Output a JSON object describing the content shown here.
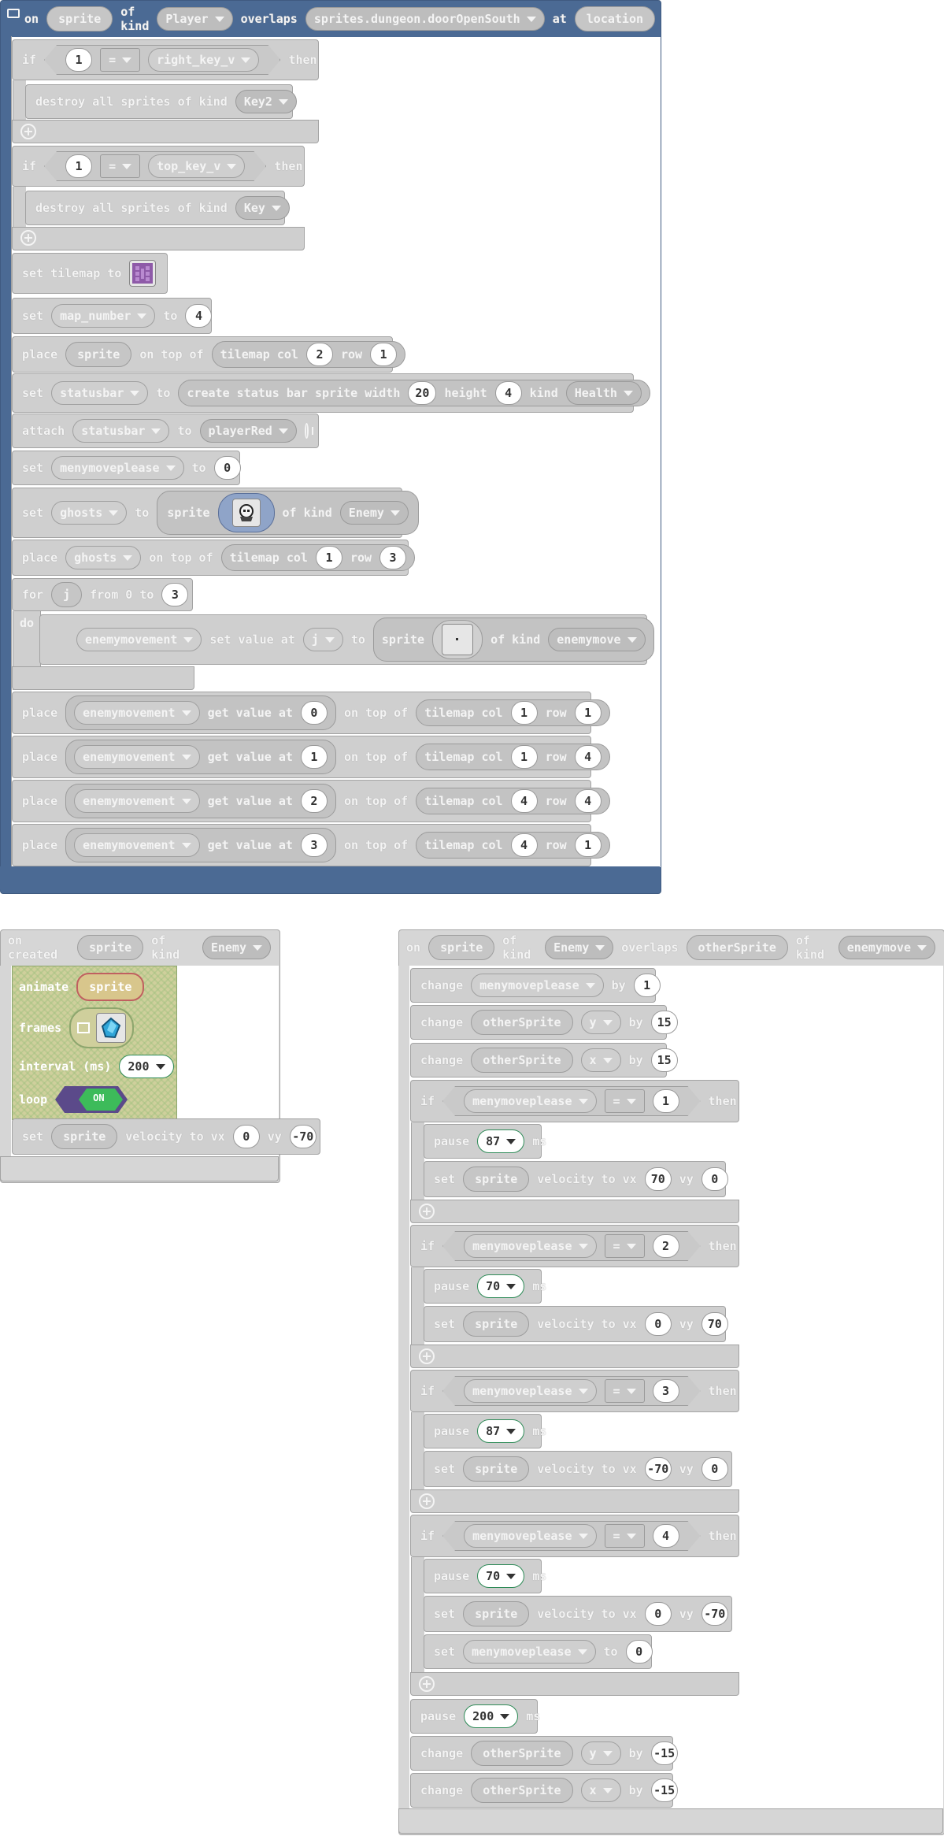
{
  "overlap_event": {
    "on": "on",
    "sprite": "sprite",
    "of_kind": "of kind",
    "player_kind": "Player",
    "overlaps": "overlaps",
    "door": "sprites.dungeon.doorOpenSouth",
    "at": "at",
    "location": "location",
    "if1": {
      "if": "if",
      "num": "1",
      "op": "=",
      "var": "right_key_v",
      "then": "then"
    },
    "destroy1": {
      "text": "destroy all sprites of kind",
      "kind": "Key2"
    },
    "if2": {
      "if": "if",
      "num": "1",
      "op": "=",
      "var": "top_key_v",
      "then": "then"
    },
    "destroy2": {
      "text": "destroy all sprites of kind",
      "kind": "Key"
    },
    "set_tilemap": "set tilemap to",
    "set_map": {
      "set": "set",
      "var": "map_number",
      "to": "to",
      "value": "4"
    },
    "place1": {
      "place": "place",
      "sprite": "sprite",
      "ontop": "on top of",
      "tilemap_col": "tilemap col",
      "col": "2",
      "row_label": "row",
      "row": "1"
    },
    "set_status": {
      "set": "set",
      "var": "statusbar",
      "to": "to",
      "create": "create status bar sprite width",
      "width": "20",
      "height_label": "height",
      "height": "4",
      "kind_label": "kind",
      "kind": "Health"
    },
    "attach": {
      "attach": "attach",
      "var": "statusbar",
      "to": "to",
      "target": "playerRed"
    },
    "set_menu": {
      "set": "set",
      "var": "menymoveplease",
      "to": "to",
      "value": "0"
    },
    "set_ghosts": {
      "set": "set",
      "var": "ghosts",
      "to": "to",
      "sprite": "sprite",
      "of_kind": "of kind",
      "kind": "Enemy"
    },
    "place2": {
      "place": "place",
      "var": "ghosts",
      "ontop": "on top of",
      "tilemap_col": "tilemap col",
      "col": "1",
      "row_label": "row",
      "row": "3"
    },
    "for": {
      "for": "for",
      "var": "j",
      "from": "from 0 to",
      "to": "3",
      "do": "do"
    },
    "for_body": {
      "var": "enemymovement",
      "setval": "set value at",
      "idx": "j",
      "to": "to",
      "sprite": "sprite",
      "of_kind": "of kind",
      "kind": "enemymove"
    },
    "places": [
      {
        "place": "place",
        "var": "enemymovement",
        "get": "get value at",
        "idx": "0",
        "ontop": "on top of",
        "tilemap_col": "tilemap col",
        "col": "1",
        "row_label": "row",
        "row": "1"
      },
      {
        "place": "place",
        "var": "enemymovement",
        "get": "get value at",
        "idx": "1",
        "ontop": "on top of",
        "tilemap_col": "tilemap col",
        "col": "1",
        "row_label": "row",
        "row": "4"
      },
      {
        "place": "place",
        "var": "enemymovement",
        "get": "get value at",
        "idx": "2",
        "ontop": "on top of",
        "tilemap_col": "tilemap col",
        "col": "4",
        "row_label": "row",
        "row": "4"
      },
      {
        "place": "place",
        "var": "enemymovement",
        "get": "get value at",
        "idx": "3",
        "ontop": "on top of",
        "tilemap_col": "tilemap col",
        "col": "4",
        "row_label": "row",
        "row": "1"
      }
    ]
  },
  "created_event": {
    "on_created": "on created",
    "sprite": "sprite",
    "of_kind": "of kind",
    "kind": "Enemy",
    "animate": "animate",
    "anim_sprite": "sprite",
    "frames": "frames",
    "interval": "interval (ms)",
    "interval_val": "200",
    "loop": "loop",
    "loop_val": "ON",
    "set_vel": {
      "set": "set",
      "sprite": "sprite",
      "velocity": "velocity to vx",
      "vx": "0",
      "vy_label": "vy",
      "vy": "-70"
    }
  },
  "overlap2": {
    "on": "on",
    "sprite": "sprite",
    "of_kind": "of kind",
    "kind": "Enemy",
    "overlaps": "overlaps",
    "other": "otherSprite",
    "of_kind2": "of kind",
    "kind2": "enemymove",
    "change1": {
      "change": "change",
      "var": "menymoveplease",
      "by": "by",
      "val": "1"
    },
    "change2": {
      "change": "change",
      "var": "otherSprite",
      "prop": "y",
      "by": "by",
      "val": "15"
    },
    "change3": {
      "change": "change",
      "var": "otherSprite",
      "prop": "x",
      "by": "by",
      "val": "15"
    },
    "ifs": [
      {
        "if": "if",
        "var": "menymoveplease",
        "op": "=",
        "num": "1",
        "then": "then",
        "pause": "pause",
        "ms_val": "87",
        "ms": "ms",
        "set": "set",
        "sprite": "sprite",
        "velocity": "velocity to vx",
        "vx": "70",
        "vy_label": "vy",
        "vy": "0"
      },
      {
        "if": "if",
        "var": "menymoveplease",
        "op": "=",
        "num": "2",
        "then": "then",
        "pause": "pause",
        "ms_val": "70",
        "ms": "ms",
        "set": "set",
        "sprite": "sprite",
        "velocity": "velocity to vx",
        "vx": "0",
        "vy_label": "vy",
        "vy": "70"
      },
      {
        "if": "if",
        "var": "menymoveplease",
        "op": "=",
        "num": "3",
        "then": "then",
        "pause": "pause",
        "ms_val": "87",
        "ms": "ms",
        "set": "set",
        "sprite": "sprite",
        "velocity": "velocity to vx",
        "vx": "-70",
        "vy_label": "vy",
        "vy": "0"
      },
      {
        "if": "if",
        "var": "menymoveplease",
        "op": "=",
        "num": "4",
        "then": "then",
        "pause": "pause",
        "ms_val": "70",
        "ms": "ms",
        "set": "set",
        "sprite": "sprite",
        "velocity": "velocity to vx",
        "vx": "0",
        "vy_label": "vy",
        "vy": "-70"
      }
    ],
    "reset": {
      "set": "set",
      "var": "menymoveplease",
      "to": "to",
      "val": "0"
    },
    "pause_end": {
      "pause": "pause",
      "val": "200",
      "ms": "ms"
    },
    "change4": {
      "change": "change",
      "var": "otherSprite",
      "prop": "y",
      "by": "by",
      "val": "-15"
    },
    "change5": {
      "change": "change",
      "var": "otherSprite",
      "prop": "x",
      "by": "by",
      "val": "-15"
    }
  },
  "colors": {
    "event_blue": "#4b6a94",
    "block_grey": "#cfcfcf",
    "anim_green": "#cfcf9c",
    "toggle_green": "#3dbb5a",
    "toggle_purple": "#5b4a8a"
  }
}
